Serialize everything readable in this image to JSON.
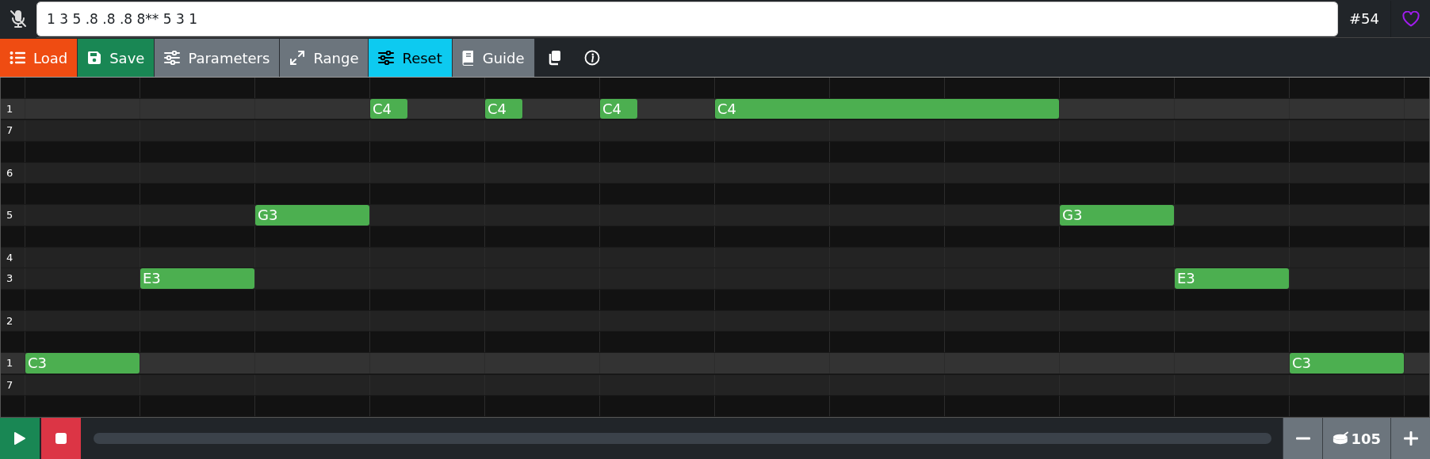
{
  "input_bar": {
    "mic_muted": true,
    "value": "1 3 5 .8 .8 .8 8** 5 3 1",
    "number": "#54",
    "favorite": false
  },
  "toolbar": [
    {
      "label": "Load",
      "color": "#ef4c12"
    },
    {
      "label": "Save",
      "color": "#198754"
    },
    {
      "label": "Parameters",
      "color": "#6c757d"
    },
    {
      "label": "Range",
      "color": "#6c757d"
    },
    {
      "label": "Reset",
      "color": "#0dcaf0"
    },
    {
      "label": "Guide",
      "color": "#6c757d"
    },
    {
      "kind": "copy"
    },
    {
      "kind": "info"
    }
  ],
  "piano_roll": {
    "rows": [
      {
        "kind": "black"
      },
      {
        "kind": "tonic",
        "label": "1",
        "steps": [
          {
            "kind": "rest"
          },
          {
            "kind": "rest"
          },
          {
            "kind": "rest"
          },
          {
            "kind": "staccato",
            "name": "C4"
          },
          {
            "kind": "staccato",
            "name": "C4"
          },
          {
            "kind": "staccato",
            "name": "C4"
          },
          {
            "kind": "held",
            "name": "C4"
          }
        ]
      },
      {
        "kind": "white",
        "label": "7"
      },
      {
        "kind": "black"
      },
      {
        "kind": "white",
        "label": "6"
      },
      {
        "kind": "black"
      },
      {
        "kind": "white",
        "label": "5",
        "steps": [
          {
            "kind": "rest"
          },
          {
            "kind": "rest"
          },
          {
            "kind": "beat",
            "name": "G3"
          },
          {
            "kind": "rest"
          },
          {
            "kind": "rest"
          },
          {
            "kind": "rest"
          },
          {
            "kind": "rest"
          },
          {
            "kind": "rest"
          },
          {
            "kind": "rest"
          },
          {
            "kind": "beat",
            "name": "G3"
          }
        ]
      },
      {
        "kind": "black"
      },
      {
        "kind": "white",
        "label": "4"
      },
      {
        "kind": "white",
        "label": "3",
        "steps": [
          {
            "kind": "rest"
          },
          {
            "kind": "beat",
            "name": "E3"
          },
          {
            "kind": "rest"
          },
          {
            "kind": "rest"
          },
          {
            "kind": "rest"
          },
          {
            "kind": "rest"
          },
          {
            "kind": "rest"
          },
          {
            "kind": "rest"
          },
          {
            "kind": "rest"
          },
          {
            "kind": "rest"
          },
          {
            "kind": "beat",
            "name": "E3"
          }
        ]
      },
      {
        "kind": "black"
      },
      {
        "kind": "white",
        "label": "2"
      },
      {
        "kind": "black"
      },
      {
        "kind": "tonic",
        "label": "1",
        "steps": [
          {
            "kind": "beat",
            "name": "C3"
          },
          {
            "kind": "rest"
          },
          {
            "kind": "rest"
          },
          {
            "kind": "rest"
          },
          {
            "kind": "rest"
          },
          {
            "kind": "rest"
          },
          {
            "kind": "rest"
          },
          {
            "kind": "rest"
          },
          {
            "kind": "rest"
          },
          {
            "kind": "rest"
          },
          {
            "kind": "rest"
          },
          {
            "kind": "beat",
            "name": "C3"
          }
        ]
      },
      {
        "kind": "white",
        "label": "7"
      },
      {
        "kind": "black"
      }
    ]
  },
  "transport": {
    "playing": false,
    "level": 0,
    "tempo": "105"
  }
}
